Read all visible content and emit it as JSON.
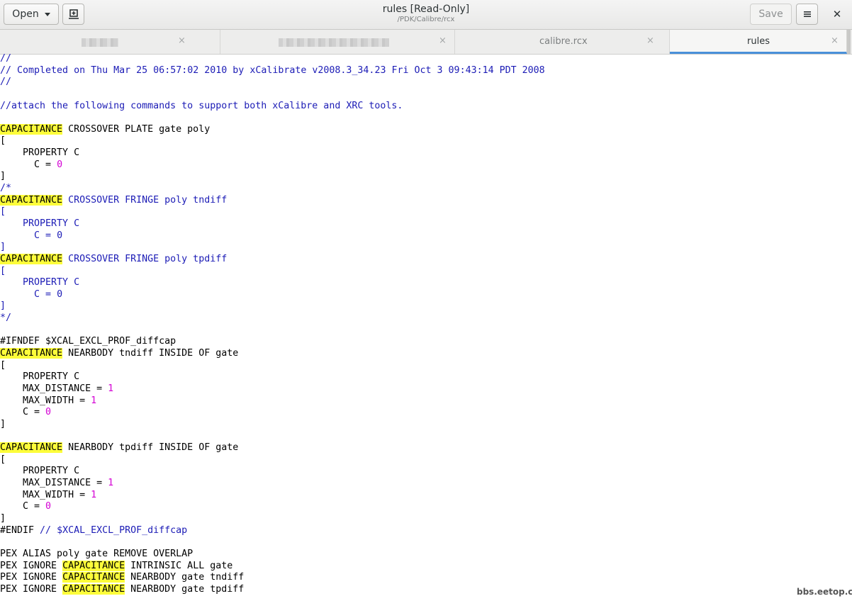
{
  "header": {
    "open_label": "Open",
    "title": "rules [Read-Only]",
    "subtitle": "/PDK/Calibre/rcx",
    "save_label": "Save"
  },
  "tabs": [
    {
      "label": "",
      "blurred": true
    },
    {
      "label": "",
      "blurred": true
    },
    {
      "label": "calibre.rcx"
    },
    {
      "label": "rules",
      "active": true
    }
  ],
  "tab_close_glyph": "×",
  "highlight_color": "#fdfd3a",
  "code_lines": [
    "//",
    "// Completed on Thu Mar 25 06:57:02 2010 by xCalibrate v2008.3_34.23 Fri Oct 3 09:43:14 PDT 2008",
    "//",
    "",
    "//attach the following commands to support both xCalibre and XRC tools.",
    "",
    "CAPACITANCE CROSSOVER PLATE gate poly",
    "[",
    "    PROPERTY C",
    "      C = 0",
    "]",
    "/*",
    "CAPACITANCE CROSSOVER FRINGE poly tndiff",
    "[",
    "    PROPERTY C",
    "      C = 0",
    "]",
    "CAPACITANCE CROSSOVER FRINGE poly tpdiff",
    "[",
    "    PROPERTY C",
    "      C = 0",
    "]",
    "*/",
    "",
    "#IFNDEF $XCAL_EXCL_PROF_diffcap",
    "CAPACITANCE NEARBODY tndiff INSIDE OF gate",
    "[",
    "    PROPERTY C",
    "    MAX_DISTANCE = 1",
    "    MAX_WIDTH = 1",
    "    C = 0",
    "]",
    "",
    "CAPACITANCE NEARBODY tpdiff INSIDE OF gate",
    "[",
    "    PROPERTY C",
    "    MAX_DISTANCE = 1",
    "    MAX_WIDTH = 1",
    "    C = 0",
    "]",
    "#ENDIF // $XCAL_EXCL_PROF_diffcap",
    "",
    "PEX ALIAS poly gate REMOVE OVERLAP",
    "PEX IGNORE CAPACITANCE INTRINSIC ALL gate",
    "PEX IGNORE CAPACITANCE NEARBODY gate tndiff",
    "PEX IGNORE CAPACITANCE NEARBODY gate tpdiff"
  ],
  "watermark": "bbs.eetop.cn"
}
